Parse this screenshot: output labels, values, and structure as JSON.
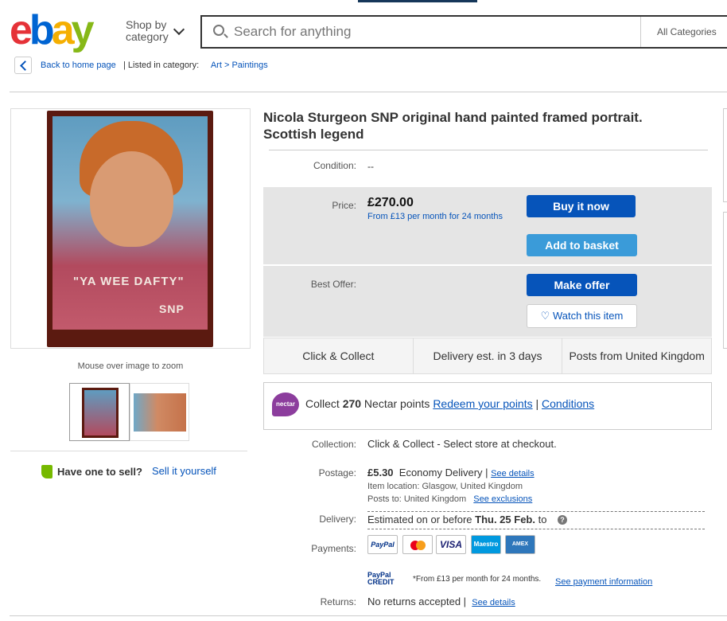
{
  "header": {
    "logo": [
      "e",
      "b",
      "a",
      "y"
    ],
    "shop_by_line1": "Shop by",
    "shop_by_line2": "category",
    "search_placeholder": "Search for anything",
    "category_select": "All Categories"
  },
  "breadcrumb": {
    "back": "Back to home page",
    "listed": "| Listed in category:",
    "cat1": "Art",
    "sep": ">",
    "cat2": "Paintings"
  },
  "gallery": {
    "painting_text1": "\"YA WEE DAFTY\"",
    "painting_text2": "SNP",
    "zoom_hint": "Mouse over image to zoom"
  },
  "sell": {
    "question": "Have one to sell?",
    "link": "Sell it yourself"
  },
  "item": {
    "title_line1": "Nicola Sturgeon SNP original hand painted framed portrait.",
    "title_line2": "Scottish legend",
    "condition_label": "Condition:",
    "condition_value": "--",
    "price_label": "Price:",
    "price": "£270.00",
    "finance": "From £13 per month for 24 months",
    "buy_now": "Buy it now",
    "add_to_basket": "Add to basket",
    "best_offer_label": "Best Offer:",
    "make_offer": "Make offer",
    "watch": "Watch this item"
  },
  "shipping_tabs": [
    "Click & Collect",
    "Delivery est. in 3 days",
    "Posts from United Kingdom"
  ],
  "nectar": {
    "logo": "nectar",
    "text_a": "Collect ",
    "points": "270",
    "text_b": " Nectar points ",
    "redeem": "Redeem your points",
    "sep": " | ",
    "conditions": "Conditions"
  },
  "details": {
    "collection_label": "Collection:",
    "collection_value": "Click & Collect - Select store at checkout.",
    "postage_label": "Postage:",
    "postage_price": "£5.30",
    "postage_type": "Economy Delivery |",
    "see_details": "See details",
    "item_location": "Item location: Glasgow, United Kingdom",
    "posts_to": "Posts to: United Kingdom",
    "see_exclusions": "See exclusions",
    "delivery_label": "Delivery:",
    "delivery_text": "Estimated on or before ",
    "delivery_date": "Thu. 25 Feb.",
    "delivery_to": " to",
    "payments_label": "Payments:",
    "payment_methods": [
      "PayPal",
      "MC",
      "VISA",
      "Maestro",
      "AMEX"
    ],
    "paypal_credit_logo": "PayPal CREDIT",
    "paypal_credit_text": "*From £13 per month for 24 months.",
    "see_payment": "See payment information",
    "returns_label": "Returns:",
    "returns_value": "No returns accepted |",
    "returns_see_details": "See details"
  }
}
